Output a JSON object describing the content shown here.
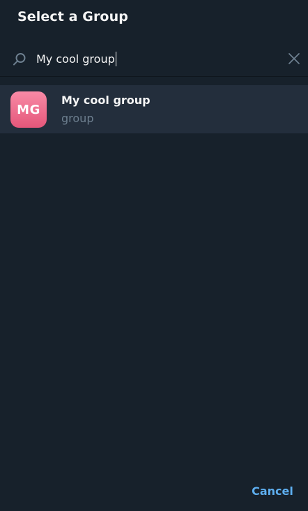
{
  "dialog": {
    "title": "Select a Group"
  },
  "search": {
    "value": "My cool group",
    "icon": "search-icon",
    "clear_icon": "close-icon"
  },
  "results": [
    {
      "initials": "MG",
      "name": "My cool group",
      "subtitle": "group",
      "avatar_colors": [
        "#f88aa6",
        "#e5577a"
      ]
    }
  ],
  "footer": {
    "cancel_label": "Cancel"
  },
  "colors": {
    "background": "#17212b",
    "selected_row": "#232e3c",
    "accent": "#5eaff0",
    "text": "#f5f5f5",
    "muted_text": "#6d7f8f"
  }
}
